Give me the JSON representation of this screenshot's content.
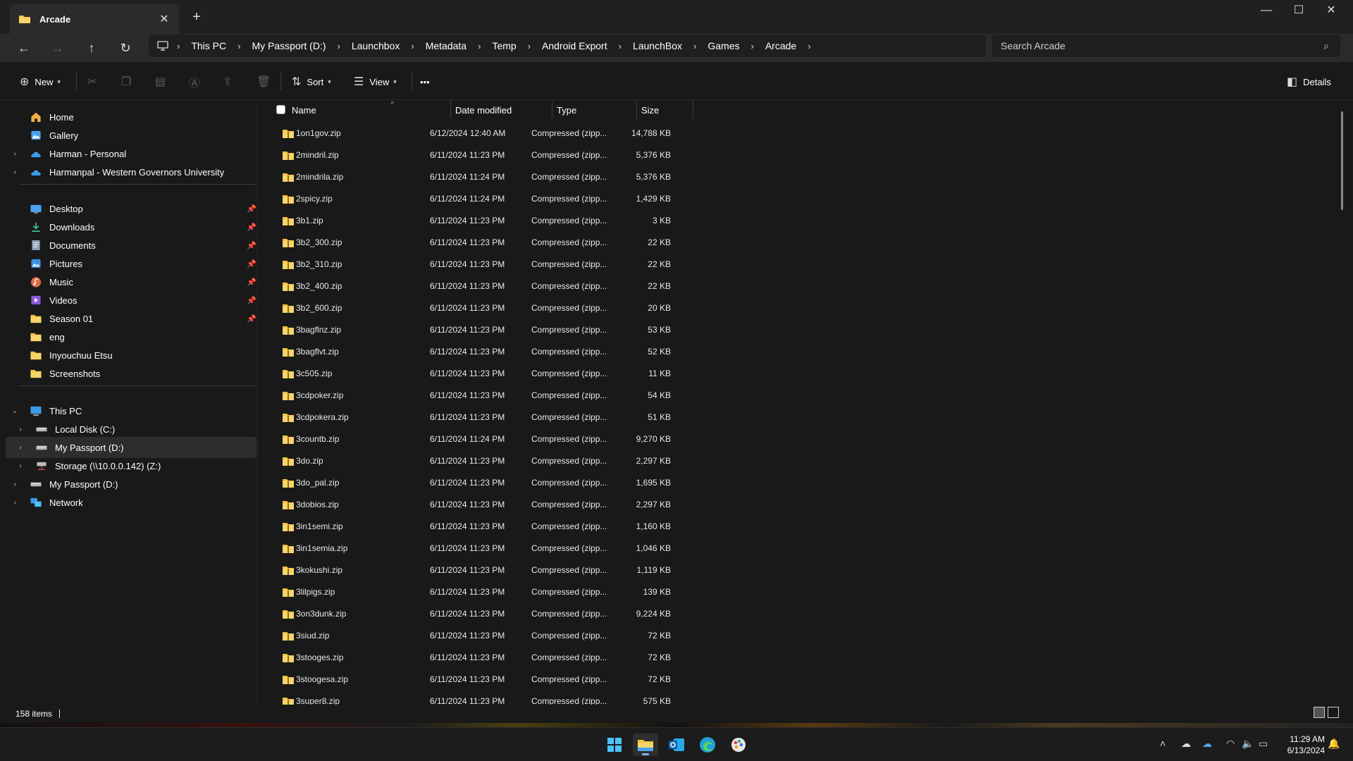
{
  "window": {
    "tab_title": "Arcade",
    "new_tab": "+",
    "controls": {
      "minimize": "—",
      "maximize": "☐",
      "close": "✕"
    }
  },
  "nav": {
    "back": "←",
    "forward": "→",
    "up": "↑",
    "refresh": "↻",
    "breadcrumbs": [
      "This PC",
      "My Passport (D:)",
      "Launchbox",
      "Metadata",
      "Temp",
      "Android Export",
      "LaunchBox",
      "Games",
      "Arcade"
    ],
    "search_placeholder": "Search Arcade"
  },
  "commands": {
    "new_label": "New",
    "sort_label": "Sort",
    "view_label": "View",
    "more_label": "•••",
    "details_label": "Details"
  },
  "sidebar": {
    "items": [
      {
        "label": "Home",
        "icon": "home-icon"
      },
      {
        "label": "Gallery",
        "icon": "gallery-icon"
      },
      {
        "label": "Harman - Personal",
        "icon": "onedrive-icon"
      },
      {
        "label": "Harmanpal - Western Governors University",
        "icon": "onedrive-icon"
      },
      {
        "label": "Desktop",
        "icon": "desktop-icon",
        "pinned": true
      },
      {
        "label": "Downloads",
        "icon": "downloads-icon",
        "pinned": true
      },
      {
        "label": "Documents",
        "icon": "documents-icon",
        "pinned": true
      },
      {
        "label": "Pictures",
        "icon": "pictures-icon",
        "pinned": true
      },
      {
        "label": "Music",
        "icon": "music-icon",
        "pinned": true
      },
      {
        "label": "Videos",
        "icon": "videos-icon",
        "pinned": true
      },
      {
        "label": "Season 01",
        "icon": "folder-icon",
        "pinned": true
      },
      {
        "label": "eng",
        "icon": "folder-icon"
      },
      {
        "label": "Inyouchuu Etsu",
        "icon": "folder-icon"
      },
      {
        "label": "Screenshots",
        "icon": "folder-icon"
      },
      {
        "label": "This PC",
        "icon": "this-pc-icon"
      },
      {
        "label": "Local Disk (C:)",
        "icon": "drive-icon"
      },
      {
        "label": "My Passport (D:)",
        "icon": "drive-icon",
        "selected": true
      },
      {
        "label": "Storage (\\\\10.0.0.142) (Z:)",
        "icon": "network-drive-icon"
      },
      {
        "label": "My Passport (D:)",
        "icon": "drive-icon"
      },
      {
        "label": "Network",
        "icon": "network-icon"
      }
    ]
  },
  "columns": {
    "name": "Name",
    "date": "Date modified",
    "type": "Type",
    "size": "Size"
  },
  "files": [
    {
      "name": "1on1gov.zip",
      "date": "6/12/2024 12:40 AM",
      "type": "Compressed (zipp...",
      "size": "14,788 KB"
    },
    {
      "name": "2mindril.zip",
      "date": "6/11/2024 11:23 PM",
      "type": "Compressed (zipp...",
      "size": "5,376 KB"
    },
    {
      "name": "2mindrila.zip",
      "date": "6/11/2024 11:24 PM",
      "type": "Compressed (zipp...",
      "size": "5,376 KB"
    },
    {
      "name": "2spicy.zip",
      "date": "6/11/2024 11:24 PM",
      "type": "Compressed (zipp...",
      "size": "1,429 KB"
    },
    {
      "name": "3b1.zip",
      "date": "6/11/2024 11:23 PM",
      "type": "Compressed (zipp...",
      "size": "3 KB"
    },
    {
      "name": "3b2_300.zip",
      "date": "6/11/2024 11:23 PM",
      "type": "Compressed (zipp...",
      "size": "22 KB"
    },
    {
      "name": "3b2_310.zip",
      "date": "6/11/2024 11:23 PM",
      "type": "Compressed (zipp...",
      "size": "22 KB"
    },
    {
      "name": "3b2_400.zip",
      "date": "6/11/2024 11:23 PM",
      "type": "Compressed (zipp...",
      "size": "22 KB"
    },
    {
      "name": "3b2_600.zip",
      "date": "6/11/2024 11:23 PM",
      "type": "Compressed (zipp...",
      "size": "20 KB"
    },
    {
      "name": "3bagflnz.zip",
      "date": "6/11/2024 11:23 PM",
      "type": "Compressed (zipp...",
      "size": "53 KB"
    },
    {
      "name": "3bagflvt.zip",
      "date": "6/11/2024 11:23 PM",
      "type": "Compressed (zipp...",
      "size": "52 KB"
    },
    {
      "name": "3c505.zip",
      "date": "6/11/2024 11:23 PM",
      "type": "Compressed (zipp...",
      "size": "11 KB"
    },
    {
      "name": "3cdpoker.zip",
      "date": "6/11/2024 11:23 PM",
      "type": "Compressed (zipp...",
      "size": "54 KB"
    },
    {
      "name": "3cdpokera.zip",
      "date": "6/11/2024 11:23 PM",
      "type": "Compressed (zipp...",
      "size": "51 KB"
    },
    {
      "name": "3countb.zip",
      "date": "6/11/2024 11:24 PM",
      "type": "Compressed (zipp...",
      "size": "9,270 KB"
    },
    {
      "name": "3do.zip",
      "date": "6/11/2024 11:23 PM",
      "type": "Compressed (zipp...",
      "size": "2,297 KB"
    },
    {
      "name": "3do_pal.zip",
      "date": "6/11/2024 11:23 PM",
      "type": "Compressed (zipp...",
      "size": "1,695 KB"
    },
    {
      "name": "3dobios.zip",
      "date": "6/11/2024 11:23 PM",
      "type": "Compressed (zipp...",
      "size": "2,297 KB"
    },
    {
      "name": "3in1semi.zip",
      "date": "6/11/2024 11:23 PM",
      "type": "Compressed (zipp...",
      "size": "1,160 KB"
    },
    {
      "name": "3in1semia.zip",
      "date": "6/11/2024 11:23 PM",
      "type": "Compressed (zipp...",
      "size": "1,046 KB"
    },
    {
      "name": "3kokushi.zip",
      "date": "6/11/2024 11:23 PM",
      "type": "Compressed (zipp...",
      "size": "1,119 KB"
    },
    {
      "name": "3lilpigs.zip",
      "date": "6/11/2024 11:23 PM",
      "type": "Compressed (zipp...",
      "size": "139 KB"
    },
    {
      "name": "3on3dunk.zip",
      "date": "6/11/2024 11:23 PM",
      "type": "Compressed (zipp...",
      "size": "9,224 KB"
    },
    {
      "name": "3siud.zip",
      "date": "6/11/2024 11:23 PM",
      "type": "Compressed (zipp...",
      "size": "72 KB"
    },
    {
      "name": "3stooges.zip",
      "date": "6/11/2024 11:23 PM",
      "type": "Compressed (zipp...",
      "size": "72 KB"
    },
    {
      "name": "3stoogesa.zip",
      "date": "6/11/2024 11:23 PM",
      "type": "Compressed (zipp...",
      "size": "72 KB"
    },
    {
      "name": "3super8.zip",
      "date": "6/11/2024 11:23 PM",
      "type": "Compressed (zipp...",
      "size": "575 KB"
    }
  ],
  "status": {
    "items_count": "158 items"
  },
  "taskbar": {
    "apps": [
      "start-icon",
      "file-explorer-icon",
      "outlook-icon",
      "edge-icon",
      "paint-icon"
    ],
    "time": "11:29 AM",
    "date": "6/13/2024"
  },
  "colors": {
    "folder": "#f3c342",
    "accent": "#4aa3f0",
    "background": "#191919"
  }
}
